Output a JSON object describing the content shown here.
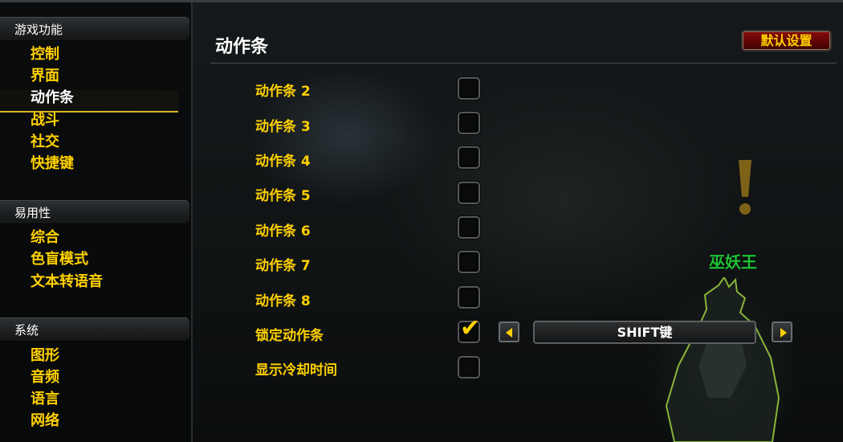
{
  "sidebar": {
    "categories": [
      {
        "label": "游戏功能",
        "items": [
          "控制",
          "界面",
          "动作条",
          "战斗",
          "社交",
          "快捷键"
        ]
      },
      {
        "label": "易用性",
        "items": [
          "综合",
          "色盲模式",
          "文本转语音"
        ]
      },
      {
        "label": "系统",
        "items": [
          "图形",
          "音频",
          "语言",
          "网络"
        ]
      }
    ],
    "selected": "动作条"
  },
  "main": {
    "title": "动作条",
    "defaults_label": "默认设置",
    "rows": [
      {
        "label": "动作条 2",
        "checked": false
      },
      {
        "label": "动作条 3",
        "checked": false
      },
      {
        "label": "动作条 4",
        "checked": false
      },
      {
        "label": "动作条 5",
        "checked": false
      },
      {
        "label": "动作条 6",
        "checked": false
      },
      {
        "label": "动作条 7",
        "checked": false
      },
      {
        "label": "动作条 8",
        "checked": false
      },
      {
        "label": "锁定动作条",
        "checked": true
      },
      {
        "label": "显示冷却时间",
        "checked": false
      }
    ],
    "lock_modifier": {
      "value": "SHIFT键"
    }
  },
  "scene": {
    "npc_name": "巫妖王"
  },
  "colors": {
    "label_gold": "#ffd100",
    "npc_green": "#1ec236",
    "button_red": "#6e0808"
  },
  "icons": {
    "check": "check-icon",
    "left": "arrow-left-icon",
    "right": "arrow-right-icon",
    "quest": "exclamation-icon"
  }
}
